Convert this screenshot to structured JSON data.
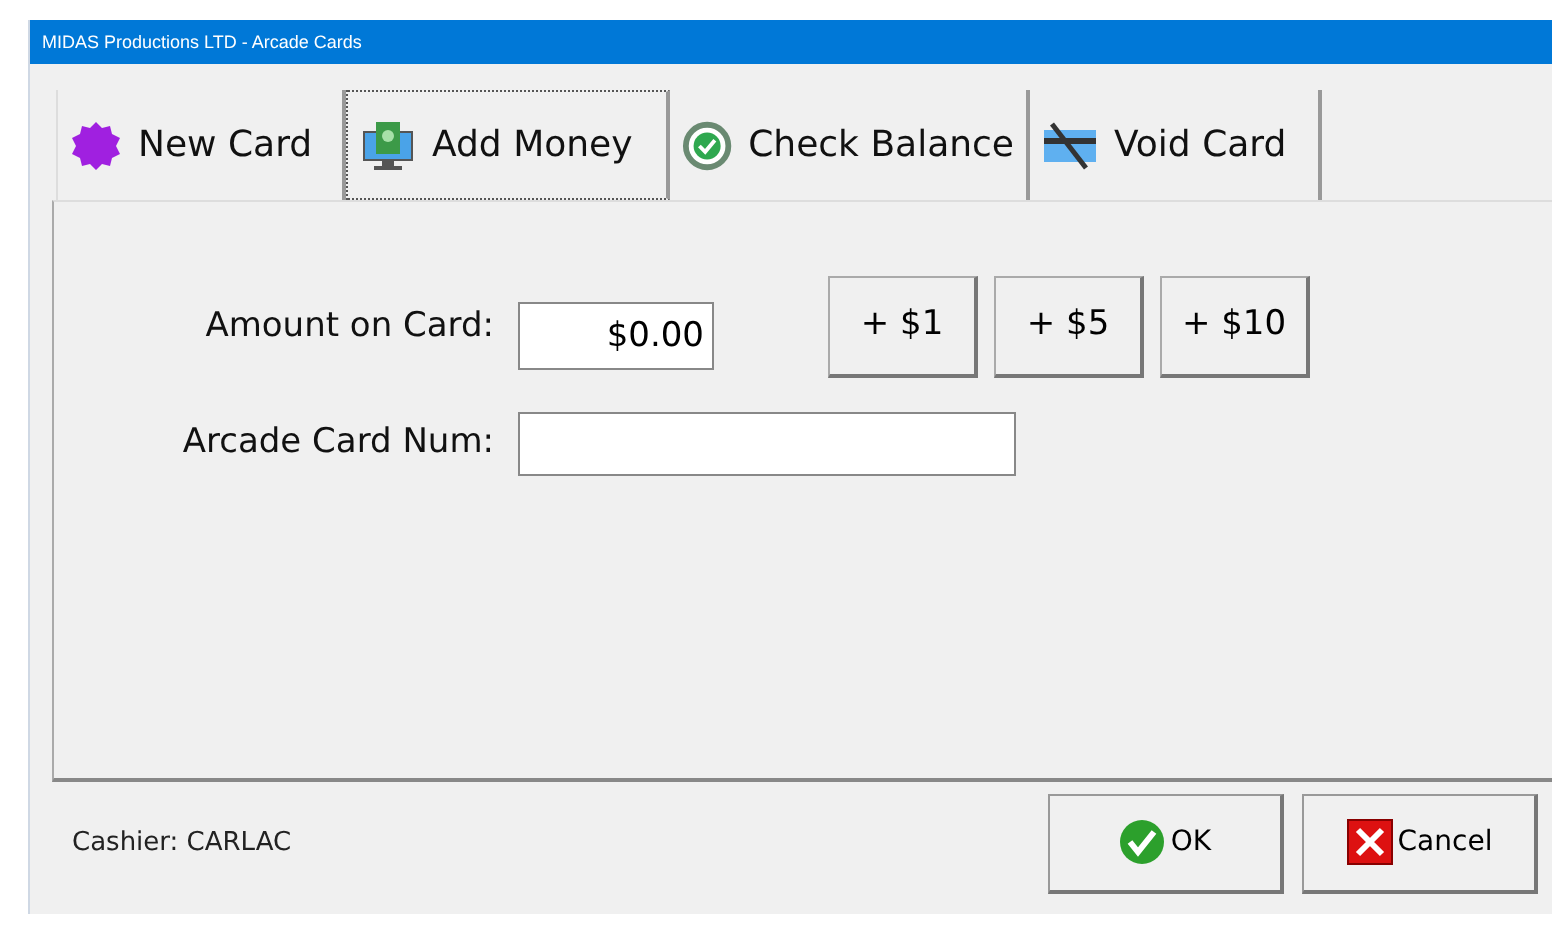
{
  "window": {
    "title": "MIDAS Productions LTD - Arcade Cards"
  },
  "tabs": [
    {
      "label": "New Card",
      "kind": "new",
      "selected": false
    },
    {
      "label": "Add Money",
      "kind": "money",
      "selected": true
    },
    {
      "label": "Check Balance",
      "kind": "check",
      "selected": false
    },
    {
      "label": "Void Card",
      "kind": "void",
      "selected": false
    }
  ],
  "form": {
    "amount_label": "Amount on Card:",
    "amount_value": "$0.00",
    "card_label": "Arcade Card Num:"
  },
  "amount_buttons": [
    "+ $1",
    "+ $5",
    "+ $10"
  ],
  "status": {
    "cashier": "Cashier: CARLAC"
  },
  "buttons": [
    {
      "label": "OK",
      "kind": "ok"
    },
    {
      "label": "Cancel",
      "kind": "cancel"
    }
  ]
}
